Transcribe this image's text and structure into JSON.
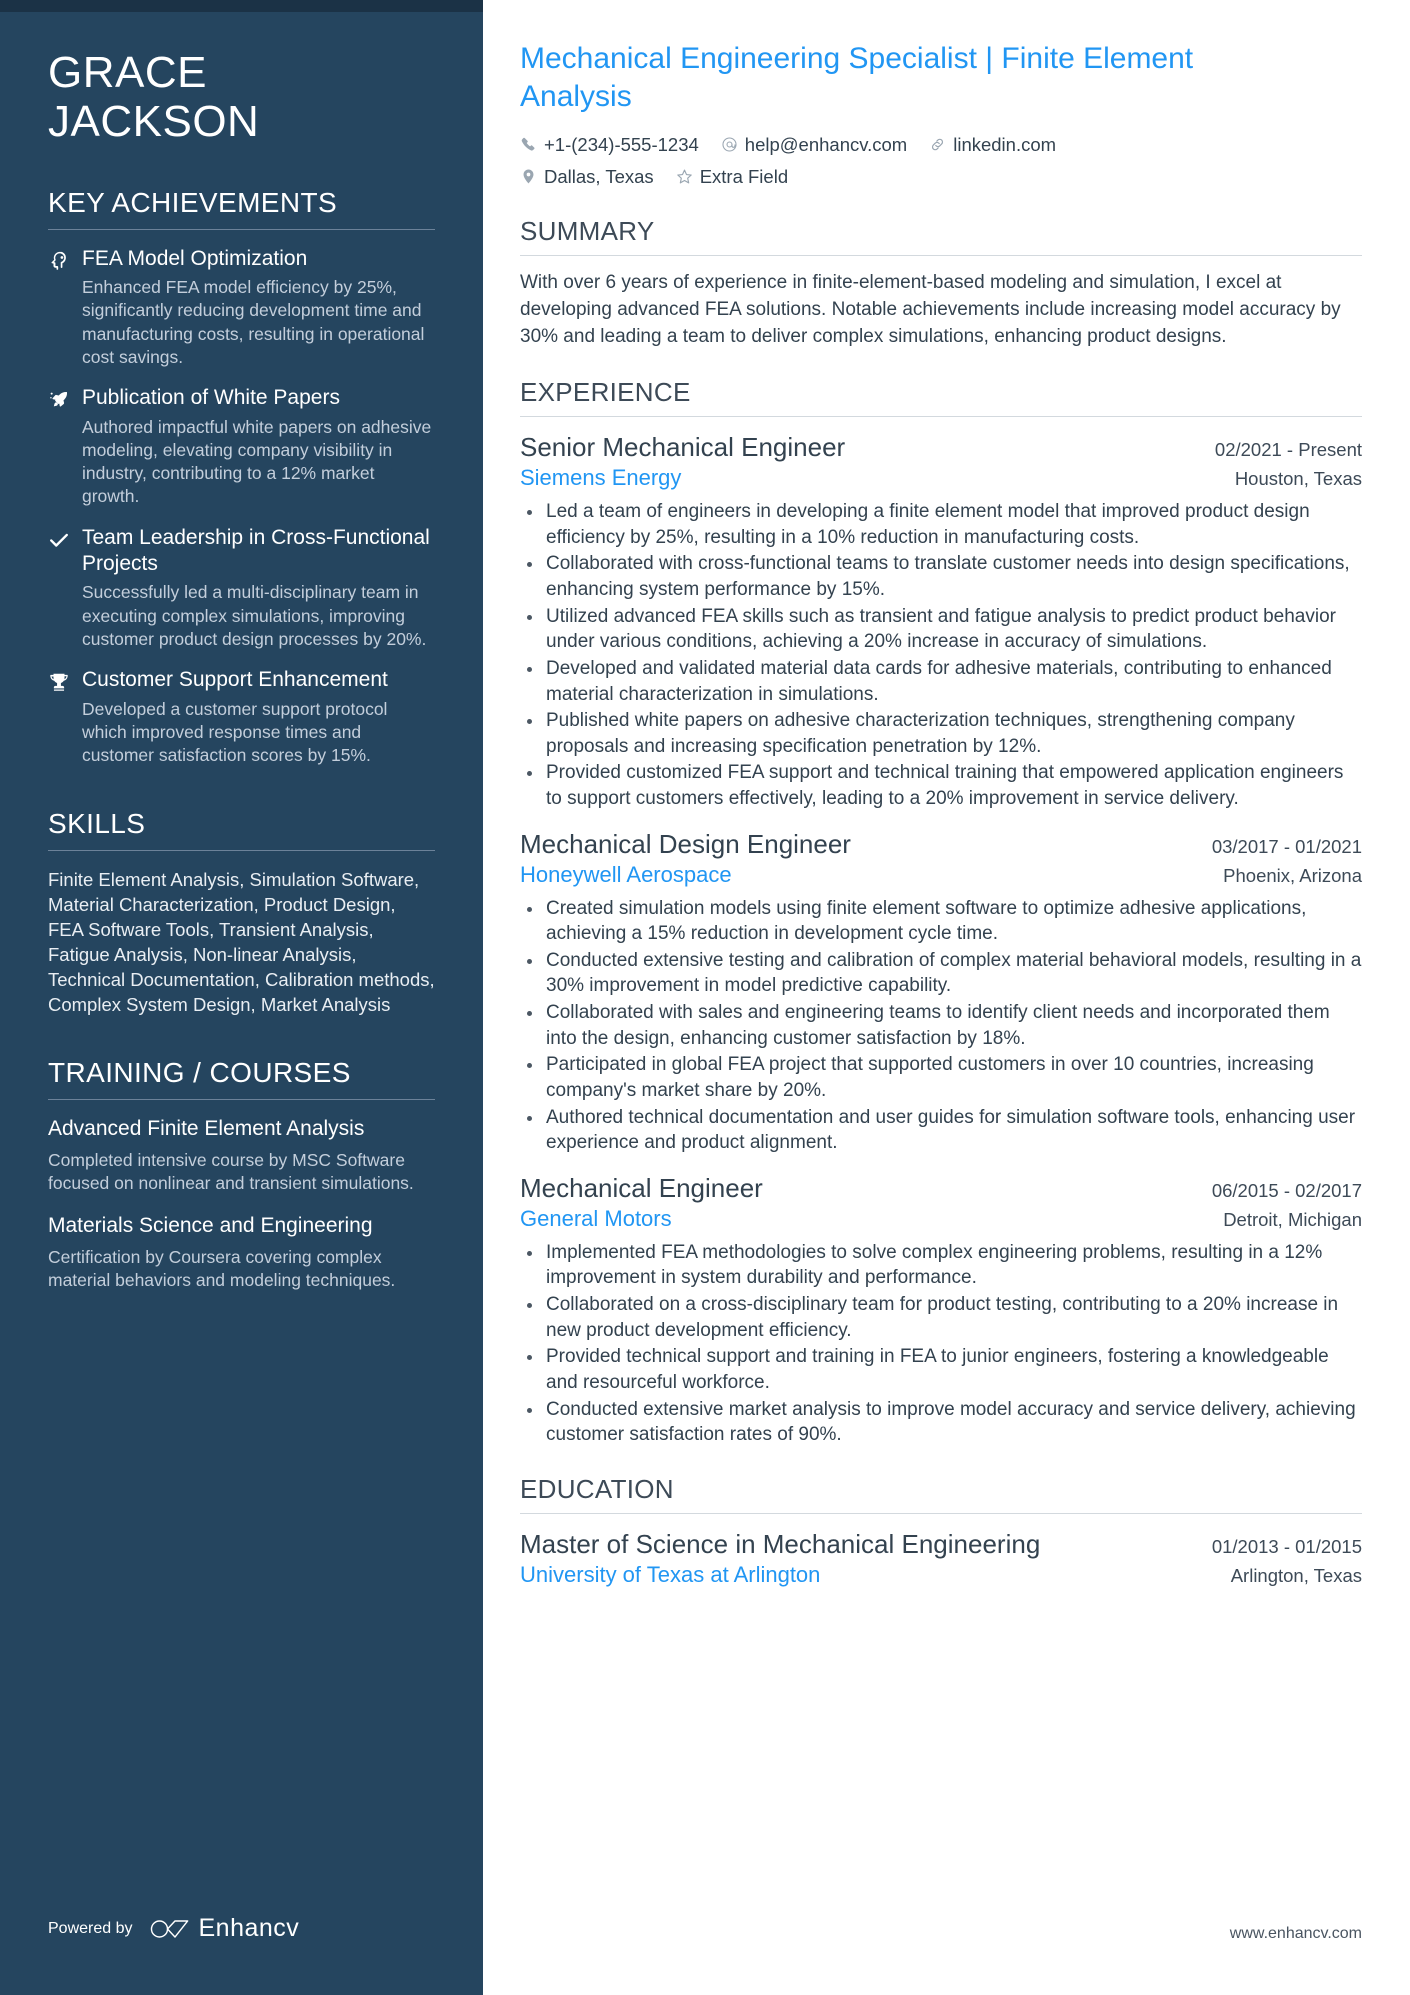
{
  "colors": {
    "sidebar_bg": "#25455f",
    "sidebar_topbar": "#1b3246",
    "accent_blue": "#2196f3",
    "body_text": "#33424f",
    "muted_text": "#c3cedb"
  },
  "sidebar": {
    "name_line1": "GRACE",
    "name_line2": "JACKSON",
    "achievements_title": "KEY ACHIEVEMENTS",
    "achievements": [
      {
        "icon": "head-idea-icon",
        "title": "FEA Model Optimization",
        "description": "Enhanced FEA model efficiency by 25%, significantly reducing development time and manufacturing costs, resulting in operational cost savings."
      },
      {
        "icon": "rocket-sparkle-icon",
        "title": "Publication of White Papers",
        "description": "Authored impactful white papers on adhesive modeling, elevating company visibility in industry, contributing to a 12% market growth."
      },
      {
        "icon": "check-icon",
        "title": "Team Leadership in Cross-Functional Projects",
        "description": "Successfully led a multi-disciplinary team in executing complex simulations, improving customer product design processes by 20%."
      },
      {
        "icon": "trophy-icon",
        "title": "Customer Support Enhancement",
        "description": "Developed a customer support protocol which improved response times and customer satisfaction scores by 15%."
      }
    ],
    "skills_title": "SKILLS",
    "skills_text": "Finite Element Analysis, Simulation Software, Material Characterization, Product Design, FEA Software Tools, Transient Analysis, Fatigue Analysis, Non-linear Analysis, Technical Documentation, Calibration methods, Complex System Design, Market Analysis",
    "training_title": "TRAINING / COURSES",
    "courses": [
      {
        "title": "Advanced Finite Element Analysis",
        "description": "Completed intensive course by MSC Software focused on nonlinear and transient simulations."
      },
      {
        "title": "Materials Science and Engineering",
        "description": "Certification by Coursera covering complex material behaviors and modeling techniques."
      }
    ],
    "footer": {
      "powered_by": "Powered by",
      "brand": "Enhancv"
    }
  },
  "main": {
    "headline": "Mechanical Engineering Specialist | Finite Element Analysis",
    "contacts": [
      {
        "icon": "phone-icon",
        "value": "+1-(234)-555-1234"
      },
      {
        "icon": "email-icon",
        "value": "help@enhancv.com"
      },
      {
        "icon": "link-icon",
        "value": "linkedin.com"
      },
      {
        "icon": "location-pin-icon",
        "value": "Dallas, Texas"
      },
      {
        "icon": "star-icon",
        "value": "Extra Field"
      }
    ],
    "summary_title": "SUMMARY",
    "summary_text": "With over 6 years of experience in finite-element-based modeling and simulation, I excel at developing advanced FEA solutions. Notable achievements include increasing model accuracy by 30% and leading a team to deliver complex simulations, enhancing product designs.",
    "experience_title": "EXPERIENCE",
    "experience": [
      {
        "title": "Senior Mechanical Engineer",
        "dates": "02/2021 - Present",
        "organization": "Siemens Energy",
        "location": "Houston, Texas",
        "bullets": [
          "Led a team of engineers in developing a finite element model that improved product design efficiency by 25%, resulting in a 10% reduction in manufacturing costs.",
          "Collaborated with cross-functional teams to translate customer needs into design specifications, enhancing system performance by 15%.",
          "Utilized advanced FEA skills such as transient and fatigue analysis to predict product behavior under various conditions, achieving a 20% increase in accuracy of simulations.",
          "Developed and validated material data cards for adhesive materials, contributing to enhanced material characterization in simulations.",
          "Published white papers on adhesive characterization techniques, strengthening company proposals and increasing specification penetration by 12%.",
          "Provided customized FEA support and technical training that empowered application engineers to support customers effectively, leading to a 20% improvement in service delivery."
        ]
      },
      {
        "title": "Mechanical Design Engineer",
        "dates": "03/2017 - 01/2021",
        "organization": "Honeywell Aerospace",
        "location": "Phoenix, Arizona",
        "bullets": [
          "Created simulation models using finite element software to optimize adhesive applications, achieving a 15% reduction in development cycle time.",
          "Conducted extensive testing and calibration of complex material behavioral models, resulting in a 30% improvement in model predictive capability.",
          "Collaborated with sales and engineering teams to identify client needs and incorporated them into the design, enhancing customer satisfaction by 18%.",
          "Participated in global FEA project that supported customers in over 10 countries, increasing company's market share by 20%.",
          "Authored technical documentation and user guides for simulation software tools, enhancing user experience and product alignment."
        ]
      },
      {
        "title": "Mechanical Engineer",
        "dates": "06/2015 - 02/2017",
        "organization": "General Motors",
        "location": "Detroit, Michigan",
        "bullets": [
          "Implemented FEA methodologies to solve complex engineering problems, resulting in a 12% improvement in system durability and performance.",
          "Collaborated on a cross-disciplinary team for product testing, contributing to a 20% increase in new product development efficiency.",
          "Provided technical support and training in FEA to junior engineers, fostering a knowledgeable and resourceful workforce.",
          "Conducted extensive market analysis to improve model accuracy and service delivery, achieving customer satisfaction rates of 90%."
        ]
      }
    ],
    "education_title": "EDUCATION",
    "education": [
      {
        "title": "Master of Science in Mechanical Engineering",
        "dates": "01/2013 - 01/2015",
        "organization": "University of Texas at Arlington",
        "location": "Arlington, Texas"
      }
    ],
    "footer_url": "www.enhancv.com"
  }
}
